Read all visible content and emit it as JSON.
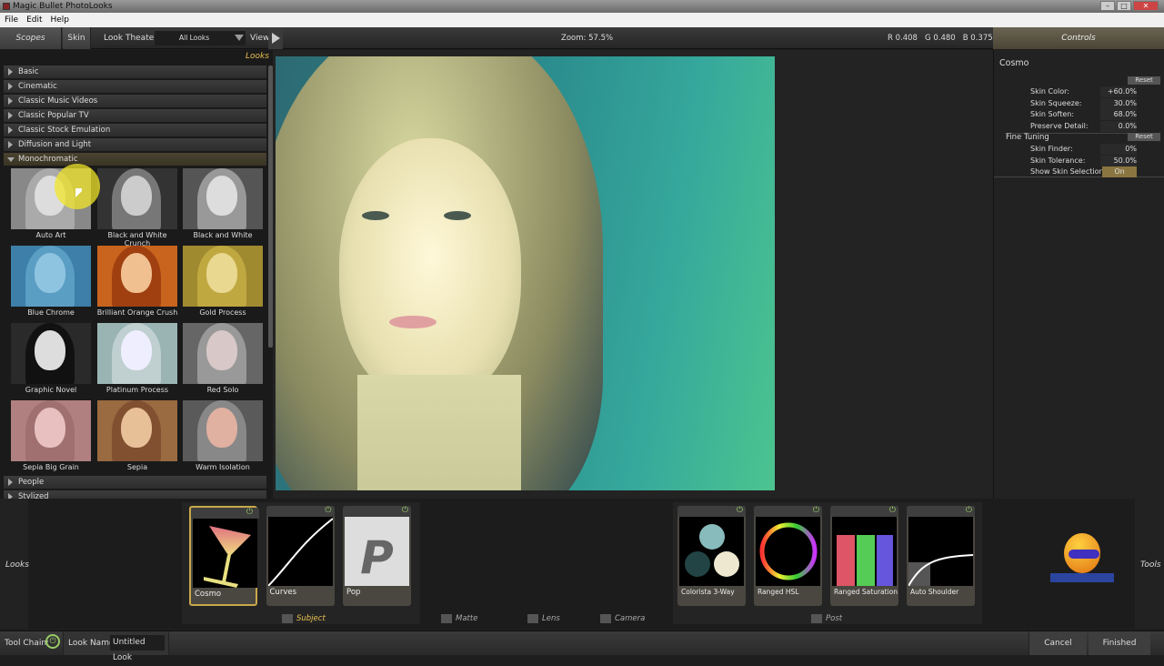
{
  "window": {
    "title": "Magic Bullet PhotoLooks",
    "controls": [
      "–",
      "□",
      "✕"
    ]
  },
  "menu": [
    "File",
    "Edit",
    "Help"
  ],
  "toolbar": {
    "scopes": "Scopes",
    "skin": "Skin",
    "look_theater": "Look Theater",
    "filter": "All Looks",
    "view": "View",
    "zoom": "Zoom: 57.5%",
    "rgb": "R 0.408   G 0.480   B 0.375",
    "controls": "Controls"
  },
  "looks_panel": {
    "title": "Looks",
    "categories_top": [
      "Basic",
      "Cinematic",
      "Classic Music Videos",
      "Classic Popular TV",
      "Classic Stock Emulation",
      "Diffusion and Light"
    ],
    "open_category": "Monochromatic",
    "thumbs": [
      {
        "label": "Auto Art",
        "bg": "#888",
        "skin": "#ddd",
        "hair": "#aaa"
      },
      {
        "label": "Black and White Crunch",
        "bg": "#333",
        "skin": "#ccc",
        "hair": "#777"
      },
      {
        "label": "Black and White",
        "bg": "#555",
        "skin": "#ddd",
        "hair": "#999"
      },
      {
        "label": "Blue Chrome",
        "bg": "#3d7fa8",
        "skin": "#8fc4e0",
        "hair": "#5b9ec4"
      },
      {
        "label": "Brilliant Orange Crush",
        "bg": "#c8641e",
        "skin": "#f0c090",
        "hair": "#a04010"
      },
      {
        "label": "Gold Process",
        "bg": "#a08a30",
        "skin": "#e8d890",
        "hair": "#c0a840"
      },
      {
        "label": "Graphic Novel",
        "bg": "#2a2a2a",
        "skin": "#ddd",
        "hair": "#111"
      },
      {
        "label": "Platinum Process",
        "bg": "#9ab4b4",
        "skin": "#eef",
        "hair": "#c0d0d0"
      },
      {
        "label": "Red Solo",
        "bg": "#666",
        "skin": "#d8c8c8",
        "hair": "#999"
      },
      {
        "label": "Sepia Big Grain",
        "bg": "#b08080",
        "skin": "#e8c0c0",
        "hair": "#a07070"
      },
      {
        "label": "Sepia",
        "bg": "#9a6a40",
        "skin": "#e8c098",
        "hair": "#805030"
      },
      {
        "label": "Warm Isolation",
        "bg": "#5a5a5a",
        "skin": "#e0b0a0",
        "hair": "#888"
      }
    ],
    "categories_bottom": [
      "People",
      "Stylized"
    ]
  },
  "controls": {
    "look": "Cosmo",
    "reset": "Reset",
    "params": [
      {
        "label": "Skin Color:",
        "value": "+60.0%"
      },
      {
        "label": "Skin Squeeze:",
        "value": "30.0%"
      },
      {
        "label": "Skin Soften:",
        "value": "68.0%"
      },
      {
        "label": "Preserve Detail:",
        "value": "0.0%"
      }
    ],
    "fine_tuning": "Fine Tuning",
    "fine_params": [
      {
        "label": "Skin Finder:",
        "value": "0%"
      },
      {
        "label": "Skin Tolerance:",
        "value": "50.0%"
      },
      {
        "label": "Show Skin Selection:",
        "value": "On"
      }
    ]
  },
  "tools": {
    "looks_label": "Looks",
    "tools_label": "Tools",
    "subject_cards": [
      "Cosmo",
      "Curves",
      "Pop"
    ],
    "post_cards": [
      "Colorista 3-Way",
      "Ranged HSL",
      "Ranged Saturation",
      "Auto Shoulder"
    ],
    "sections": [
      "Subject",
      "Matte",
      "Lens",
      "Camera",
      "Post"
    ],
    "pop_letter": "P"
  },
  "status": {
    "tool_chain": "Tool Chain:",
    "look_name_label": "Look Name:",
    "look_name": "Untitled Look",
    "cancel": "Cancel",
    "finished": "Finished"
  },
  "colors": {
    "accent": "#c8a84a",
    "power": "#9c6"
  }
}
